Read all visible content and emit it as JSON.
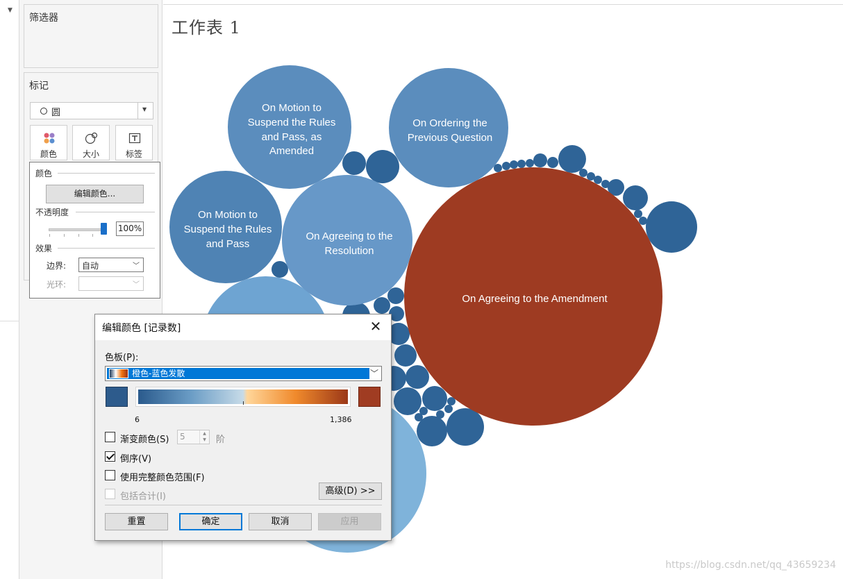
{
  "side_panel": {
    "filters_title": "筛选器",
    "marks_title": "标记",
    "mark_type": "圆",
    "mark_buttons": [
      {
        "label": "颜色",
        "icon": "color-dots-icon"
      },
      {
        "label": "大小",
        "icon": "size-circles-icon"
      },
      {
        "label": "标签",
        "icon": "label-T-icon"
      }
    ],
    "color_popover": {
      "section_color": "颜色",
      "edit_colors_button": "编辑颜色...",
      "section_opacity": "不透明度",
      "opacity_value": "100%",
      "opacity_fraction": 1.0,
      "section_effects": "效果",
      "border_label": "边界:",
      "border_value": "自动",
      "halo_label": "光环:",
      "halo_value": ""
    }
  },
  "worksheet": {
    "title": "工作表 1",
    "bubbles_labels": {
      "amendment": "On Agreeing to the Amendment",
      "suspend_amended": [
        "On Motion to",
        "Suspend the Rules",
        "and Pass, as",
        "Amended"
      ],
      "previous_question": [
        "On Ordering the",
        "Previous Question"
      ],
      "suspend_pass": [
        "On Motion to",
        "Suspend the Rules",
        "and Pass"
      ],
      "resolution": [
        "On Agreeing to the",
        "Resolution"
      ]
    },
    "colors": {
      "large_orange": "#9e3b22",
      "light_blue": "#6a9fcc",
      "mid_blue": "#5a8dbc",
      "dark_blue": "#2e6496"
    },
    "watermark": "https://blog.csdn.net/qq_43659234"
  },
  "dialog": {
    "title": "编辑颜色 [记录数]",
    "palette_label": "色板(P):",
    "palette_value": "橙色-蓝色发散",
    "range_min": "6",
    "range_max": "1,386",
    "stepped_label": "渐变颜色(S)",
    "stepped_checked": false,
    "steps_value": "5",
    "steps_unit": "阶",
    "reversed_label": "倒序(V)",
    "reversed_checked": true,
    "full_range_label": "使用完整颜色范围(F)",
    "full_range_checked": false,
    "include_totals_label": "包括合计(I)",
    "include_totals_checked": false,
    "advanced_button": "高级(D) >>",
    "buttons": {
      "reset": "重置",
      "ok": "确定",
      "cancel": "取消",
      "apply": "应用"
    }
  }
}
